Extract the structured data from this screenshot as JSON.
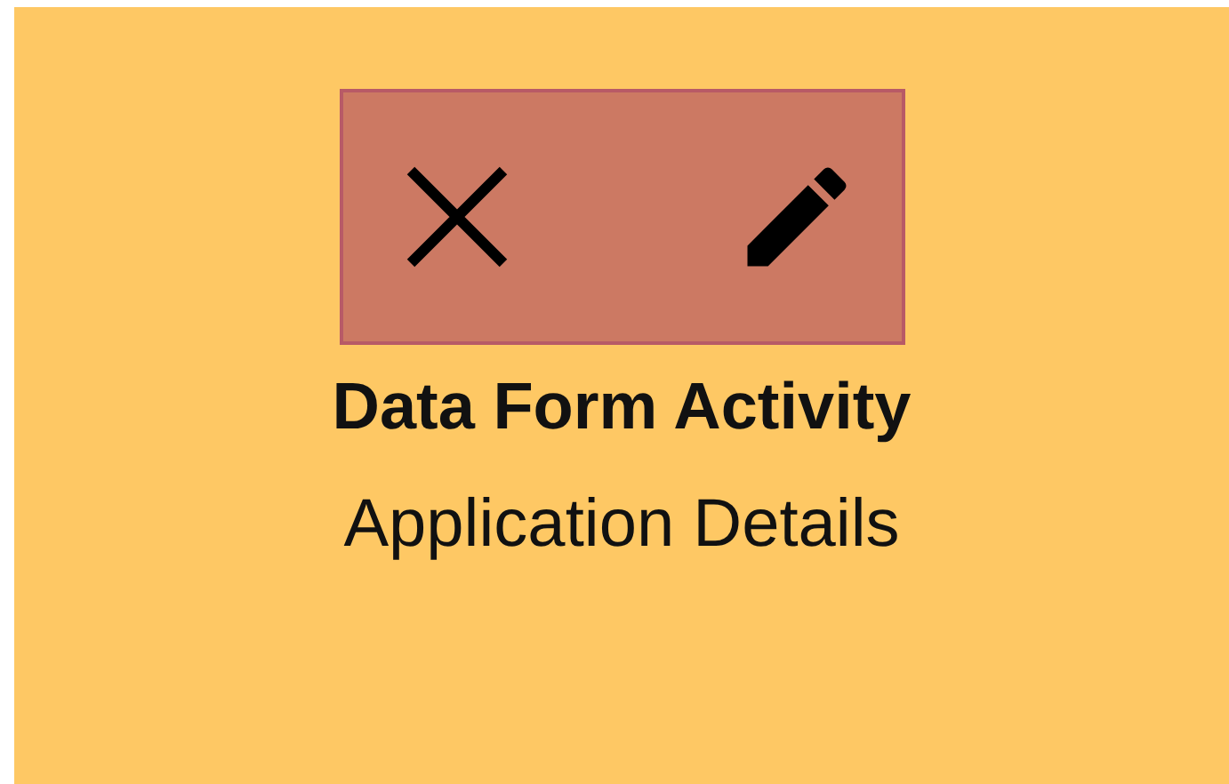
{
  "card": {
    "title": "Data Form Activity",
    "subtitle": "Application Details"
  }
}
